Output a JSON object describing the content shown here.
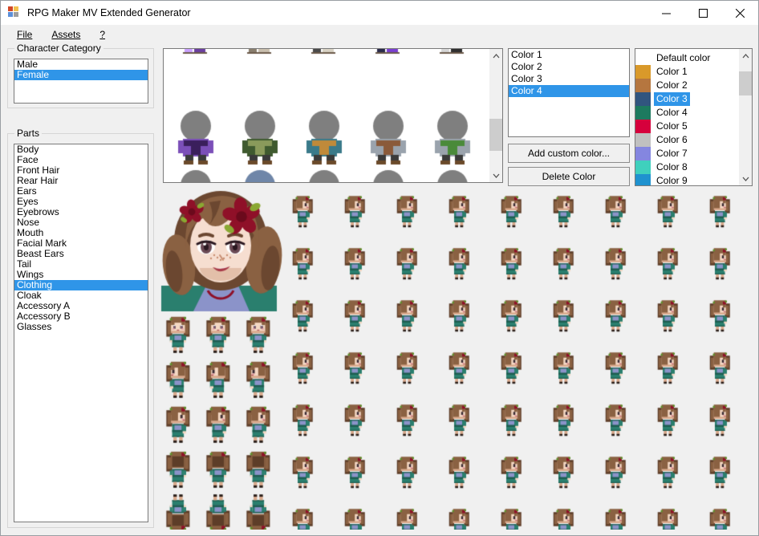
{
  "window": {
    "title": "RPG Maker MV Extended Generator",
    "icon": "app-icon",
    "minimize_label": "─",
    "maximize_label": "□",
    "close_label": "✕"
  },
  "menubar": {
    "items": [
      {
        "label": "File",
        "mnemonic": "F"
      },
      {
        "label": "Assets",
        "mnemonic": "A"
      },
      {
        "label": "?",
        "mnemonic": "?"
      }
    ]
  },
  "character_category": {
    "title": "Character Category",
    "items": [
      {
        "label": "Male",
        "selected": false
      },
      {
        "label": "Female",
        "selected": true
      }
    ]
  },
  "parts": {
    "title": "Parts",
    "items": [
      {
        "label": "Body",
        "selected": false
      },
      {
        "label": "Face",
        "selected": false
      },
      {
        "label": "Front Hair",
        "selected": false
      },
      {
        "label": "Rear Hair",
        "selected": false
      },
      {
        "label": "Ears",
        "selected": false
      },
      {
        "label": "Eyes",
        "selected": false
      },
      {
        "label": "Eyebrows",
        "selected": false
      },
      {
        "label": "Nose",
        "selected": false
      },
      {
        "label": "Mouth",
        "selected": false
      },
      {
        "label": "Facial Mark",
        "selected": false
      },
      {
        "label": "Beast Ears",
        "selected": false
      },
      {
        "label": "Tail",
        "selected": false
      },
      {
        "label": "Wings",
        "selected": false
      },
      {
        "label": "Clothing",
        "selected": true
      },
      {
        "label": "Cloak",
        "selected": false
      },
      {
        "label": "Accessory A",
        "selected": false
      },
      {
        "label": "Accessory B",
        "selected": false
      },
      {
        "label": "Glasses",
        "selected": false
      }
    ]
  },
  "parts_preview": {
    "name": "clothing-variant-preview",
    "columns": 5,
    "scrollbar": {
      "up_arrow": "⌃",
      "down_arrow": "⌄",
      "thumb_top_pct": 52,
      "thumb_height_pct": 30
    },
    "variants": [
      {
        "row": 0,
        "col": 0,
        "body": "#6b3fa0",
        "accent": "#c9a0ff",
        "partial": true
      },
      {
        "row": 0,
        "col": 1,
        "body": "#c9bfae",
        "accent": "#8a7f6e",
        "partial": true
      },
      {
        "row": 0,
        "col": 2,
        "body": "#d8d2c4",
        "accent": "#4a4a4a",
        "partial": true
      },
      {
        "row": 0,
        "col": 3,
        "body": "#7a3fd0",
        "accent": "#2a2a4a",
        "partial": true
      },
      {
        "row": 0,
        "col": 4,
        "body": "#2f2f2f",
        "accent": "#d6d6d6",
        "partial": true
      },
      {
        "row": 1,
        "col": 0,
        "body": "#7b4fb8",
        "accent": "#3a1f5c"
      },
      {
        "row": 1,
        "col": 1,
        "body": "#3f5a2f",
        "accent": "#8a9a5b"
      },
      {
        "row": 1,
        "col": 2,
        "body": "#3a7a8a",
        "accent": "#c08a3a"
      },
      {
        "row": 1,
        "col": 3,
        "body": "#9aa3ad",
        "accent": "#8a5a3a"
      },
      {
        "row": 1,
        "col": 4,
        "body": "#9aa3ad",
        "accent": "#4a8a3a"
      },
      {
        "row": 2,
        "col": 0,
        "body": "#8a8fa8",
        "accent": "#5a8f9a"
      },
      {
        "row": 2,
        "col": 1,
        "body": "#6f86a8",
        "accent": "#b05a6a",
        "head": "#6f86a8"
      },
      {
        "row": 2,
        "col": 2,
        "body": "#3a3a3a",
        "accent": "#c06a2a"
      },
      {
        "row": 2,
        "col": 3,
        "body": "#3a3a3a",
        "accent": "#2a5a9a"
      },
      {
        "row": 2,
        "col": 4,
        "body": "#3a3a3a",
        "accent": "#d9932a"
      }
    ]
  },
  "color_list": {
    "name": "applied-color-slots",
    "items": [
      {
        "label": "Color 1",
        "selected": false
      },
      {
        "label": "Color 2",
        "selected": false
      },
      {
        "label": "Color 3",
        "selected": false
      },
      {
        "label": "Color 4",
        "selected": true
      }
    ]
  },
  "buttons": {
    "add_custom_color": "Add custom color...",
    "delete_color": "Delete Color"
  },
  "palette": {
    "name": "color-palette-list",
    "scrollbar": {
      "up_arrow": "⌃",
      "down_arrow": "⌄",
      "thumb_top_pct": 8,
      "thumb_height_pct": 22
    },
    "items": [
      {
        "label": "Default color",
        "swatch": null,
        "selected": false
      },
      {
        "label": "Color 1",
        "swatch": "#d9992a",
        "selected": false
      },
      {
        "label": "Color 2",
        "swatch": "#b5763f",
        "selected": false
      },
      {
        "label": "Color 3",
        "swatch": "#31557f",
        "selected": true
      },
      {
        "label": "Color 4",
        "swatch": "#1d7a5f",
        "selected": false
      },
      {
        "label": "Color 5",
        "swatch": "#d6003c",
        "selected": false
      },
      {
        "label": "Color 6",
        "swatch": "#c0c0c0",
        "selected": false
      },
      {
        "label": "Color 7",
        "swatch": "#8486e0",
        "selected": false
      },
      {
        "label": "Color 8",
        "swatch": "#3fd0bd",
        "selected": false
      },
      {
        "label": "Color 9",
        "swatch": "#1f92cf",
        "selected": false
      }
    ]
  },
  "character_preview": {
    "name": "generated-character-sheets",
    "face": {
      "description": "Face portrait of female character",
      "hair_color": "#8a6142",
      "hair_shadow": "#6b4730",
      "skin": "#f6ded0",
      "skin_shadow": "#e3bfa9",
      "eye_color": "#6b4a55",
      "flower_color": "#8f1028",
      "leaf_color": "#8aa832",
      "clothing_color": "#2a7f6e",
      "collar_color": "#8b93c9",
      "width": 144,
      "height": 144
    },
    "walk_sheet": {
      "columns": 3,
      "rows": 5,
      "cell": 48
    },
    "battler_sheet": {
      "columns": 9,
      "rows": 9,
      "cell": 64
    },
    "sprite_colors": {
      "hair": "#8a6142",
      "hair_dark": "#5d3d28",
      "skin": "#f4d8c4",
      "skin_shade": "#d9a98c",
      "top": "#2a7f6e",
      "top_dark": "#1d5e51",
      "shirt": "#8b93c9",
      "shirt_dark": "#6a72a8",
      "skirt": "#2a7f6e",
      "shoes": "#2a1f1a",
      "flower": "#8f1028",
      "leaf": "#5f8f2a",
      "outline": "#241812"
    },
    "background": "#f0f0f0"
  }
}
